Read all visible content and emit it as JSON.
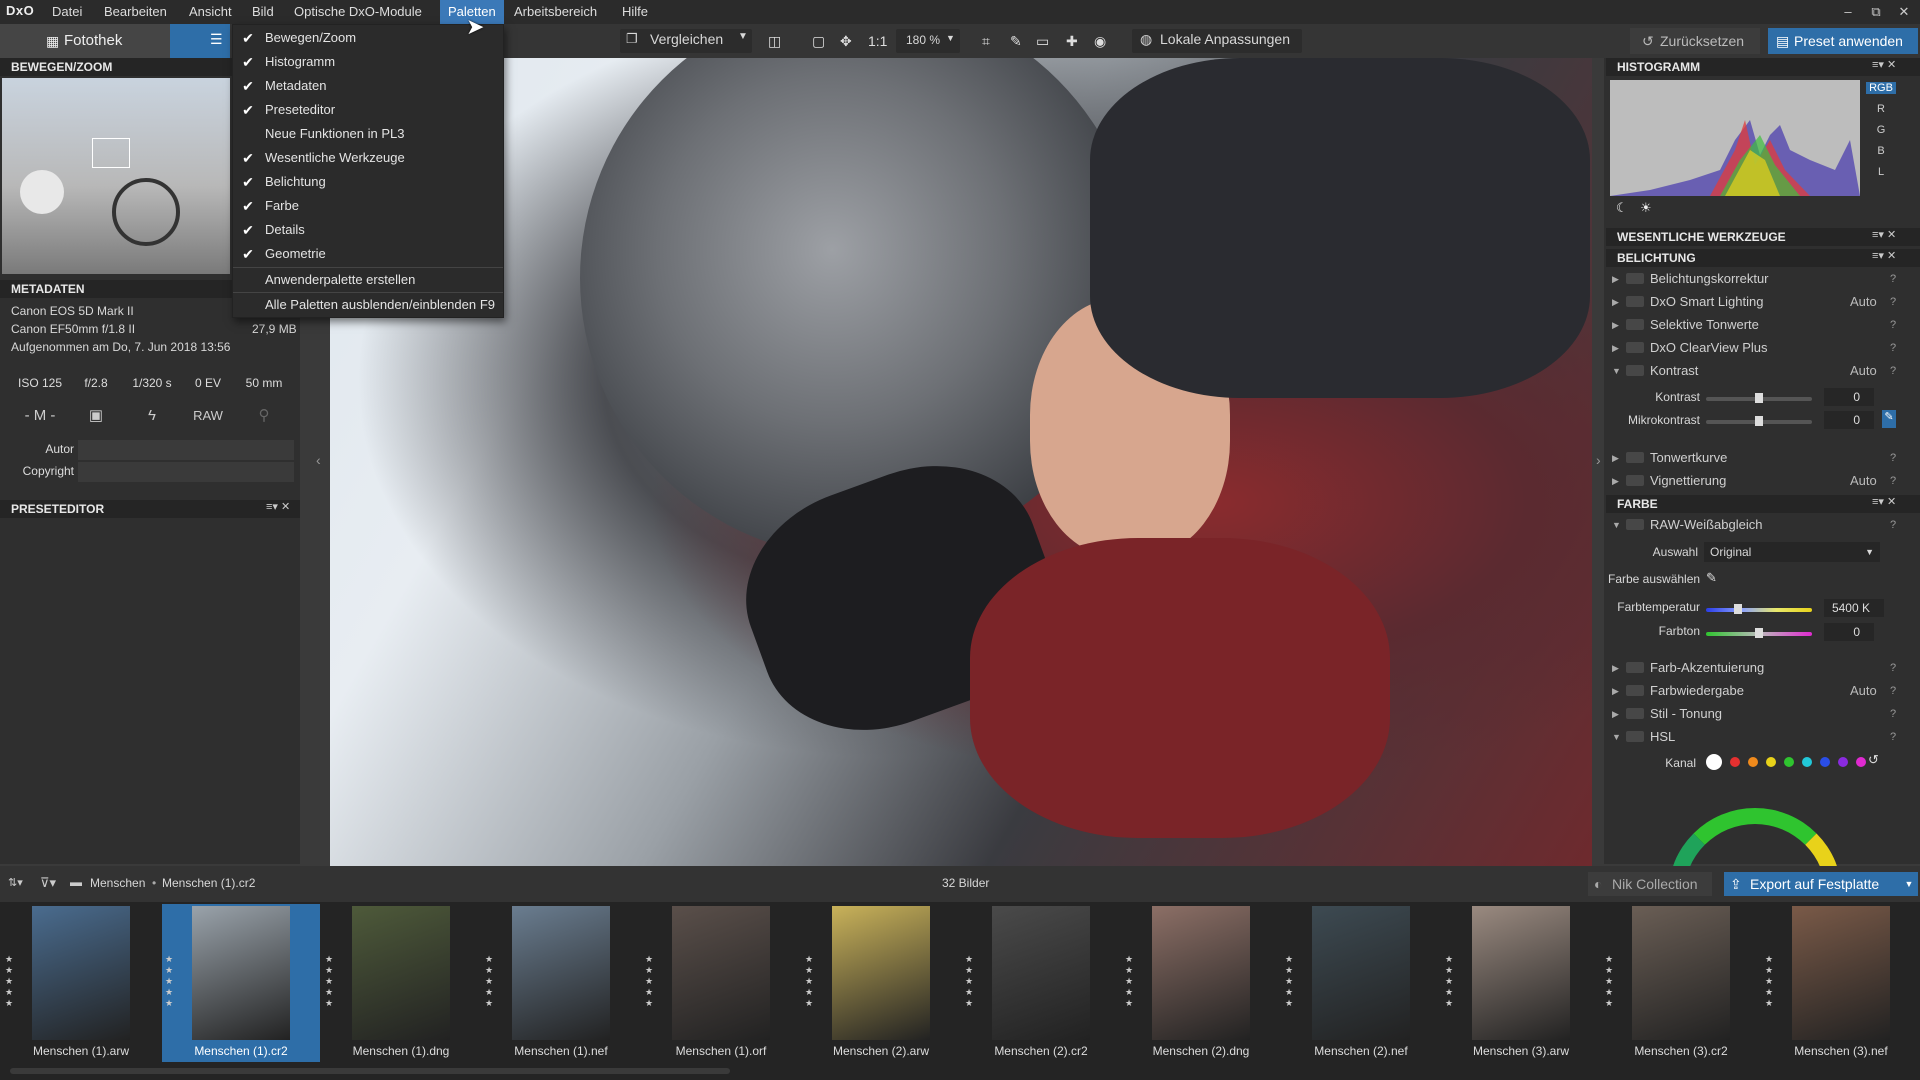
{
  "menubar": {
    "logo": "DxO",
    "items": [
      "Datei",
      "Bearbeiten",
      "Ansicht",
      "Bild",
      "Optische DxO-Module",
      "Paletten",
      "Arbeitsbereich",
      "Hilfe"
    ],
    "window_buttons": [
      "–",
      "⧉",
      "✕"
    ]
  },
  "toolbar": {
    "fotothek": "Fotothek",
    "compare": "Vergleichen",
    "ratio": "1:1",
    "zoom": "180 %",
    "local": "Lokale Anpassungen",
    "reset": "Zurücksetzen",
    "apply": "Preset anwenden"
  },
  "dropdown": {
    "items": [
      {
        "label": "Bewegen/Zoom",
        "checked": "✔"
      },
      {
        "label": "Histogramm",
        "checked": "✔"
      },
      {
        "label": "Metadaten",
        "checked": "✔"
      },
      {
        "label": "Preseteditor",
        "checked": "✔"
      },
      {
        "label": "Neue Funktionen in PL3",
        "checked": ""
      },
      {
        "label": "Wesentliche Werkzeuge",
        "checked": "✔"
      },
      {
        "label": "Belichtung",
        "checked": "✔"
      },
      {
        "label": "Farbe",
        "checked": "✔"
      },
      {
        "label": "Details",
        "checked": "✔"
      },
      {
        "label": "Geometrie",
        "checked": "✔"
      }
    ],
    "create": "Anwenderpalette erstellen",
    "toggle": "Alle Paletten ausblenden/einblenden",
    "toggle_shortcut": "F9"
  },
  "left": {
    "nav_title": "BEWEGEN/ZOOM",
    "meta_title": "METADATEN",
    "camera": "Canon EOS 5D Mark II",
    "lens": "Canon EF50mm f/1.8 II",
    "size": "27,9 MB",
    "taken": "Aufgenommen am Do, 7. Jun 2018 13:56",
    "exif": [
      "ISO 125",
      "f/2.8",
      "1/320 s",
      "0 EV",
      "50 mm"
    ],
    "mode": "- M -",
    "raw": "RAW",
    "author_label": "Autor",
    "copyright_label": "Copyright",
    "preset_title": "PRESETEDITOR"
  },
  "right": {
    "histogram_title": "HISTOGRAMM",
    "channels": [
      "RGB",
      "R",
      "G",
      "B",
      "L"
    ],
    "essential_title": "WESENTLICHE WERKZEUGE",
    "exposure_title": "BELICHTUNG",
    "exposure_items": [
      {
        "label": "Belichtungskorrektur",
        "auto": ""
      },
      {
        "label": "DxO Smart Lighting",
        "auto": "Auto"
      },
      {
        "label": "Selektive Tonwerte",
        "auto": ""
      },
      {
        "label": "DxO ClearView Plus",
        "auto": ""
      },
      {
        "label": "Kontrast",
        "auto": "Auto"
      }
    ],
    "contrast_label": "Kontrast",
    "contrast_value": "0",
    "micro_label": "Mikrokontrast",
    "micro_value": "0",
    "exposure_items2": [
      {
        "label": "Tonwertkurve",
        "auto": ""
      },
      {
        "label": "Vignettierung",
        "auto": "Auto"
      }
    ],
    "color_title": "FARBE",
    "wb_label": "RAW-Weißabgleich",
    "select_label": "Auswahl",
    "select_value": "Original",
    "pick_label": "Farbe auswählen",
    "temp_label": "Farbtemperatur",
    "temp_value": "5400 K",
    "tint_label": "Farbton",
    "tint_value": "0",
    "color_items": [
      {
        "label": "Farb-Akzentuierung",
        "auto": ""
      },
      {
        "label": "Farbwiedergabe",
        "auto": "Auto"
      },
      {
        "label": "Stil - Tonung",
        "auto": ""
      },
      {
        "label": "HSL",
        "auto": ""
      }
    ],
    "channel_label": "Kanal",
    "swatches": [
      "#ffffff",
      "#e53030",
      "#f08a1c",
      "#e8d21a",
      "#2fc42f",
      "#22c8d8",
      "#2a4ee8",
      "#8a2ae0",
      "#e02ad0"
    ]
  },
  "filmbar": {
    "folder": "Menschen",
    "file": "Menschen (1).cr2",
    "count": "32 Bilder",
    "nik": "Nik Collection",
    "export": "Export auf Festplatte"
  },
  "thumbnails": [
    {
      "name": "Menschen (1).arw",
      "color": "#4a6c8f"
    },
    {
      "name": "Menschen (1).cr2",
      "color": "#9aa3ab"
    },
    {
      "name": "Menschen (1).dng",
      "color": "#4e5a3a"
    },
    {
      "name": "Menschen (1).nef",
      "color": "#6a7d90"
    },
    {
      "name": "Menschen (1).orf",
      "color": "#5a4f4a"
    },
    {
      "name": "Menschen (2).arw",
      "color": "#c9b25a"
    },
    {
      "name": "Menschen (2).cr2",
      "color": "#4a4a4a"
    },
    {
      "name": "Menschen (2).dng",
      "color": "#8c6f66"
    },
    {
      "name": "Menschen (2).nef",
      "color": "#3d4a52"
    },
    {
      "name": "Menschen (3).arw",
      "color": "#9a8a80"
    },
    {
      "name": "Menschen (3).cr2",
      "color": "#6a5e55"
    },
    {
      "name": "Menschen (3).nef",
      "color": "#7a5a48"
    }
  ]
}
